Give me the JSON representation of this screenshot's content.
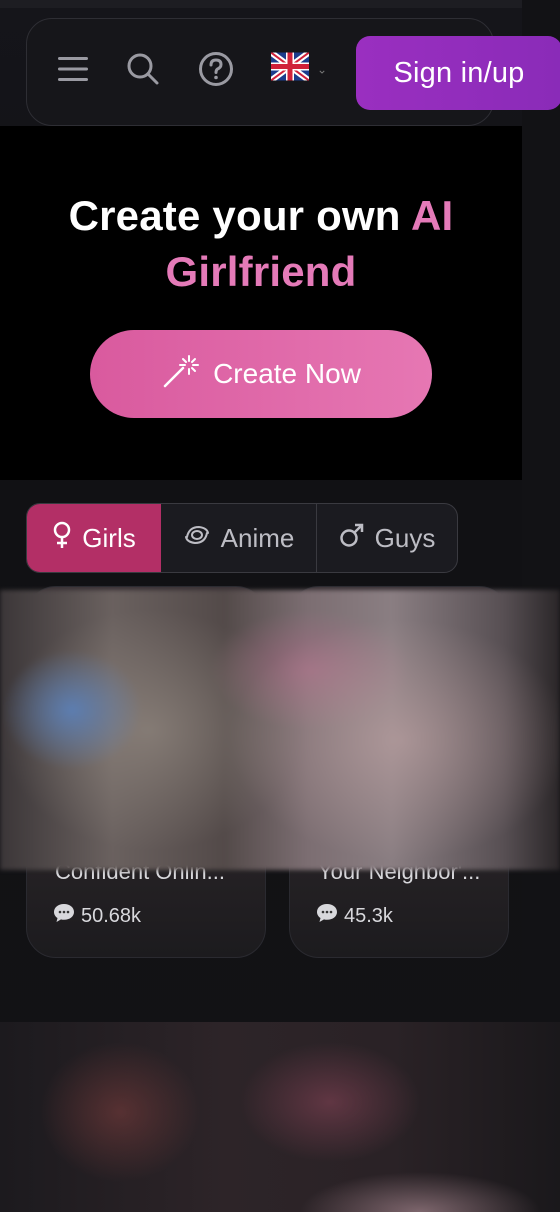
{
  "header": {
    "signin_label": "Sign in/up",
    "icons": [
      "menu-icon",
      "search-icon",
      "help-icon",
      "uk-flag-icon",
      "chevron-down-icon"
    ]
  },
  "hero": {
    "title_part1": "Create your own ",
    "title_accent1": "AI",
    "title_accent2": "Girlfriend",
    "button_label": "Create Now",
    "accent_color": "#e47ab8"
  },
  "tabs": [
    {
      "label": "Girls",
      "icon": "female-icon",
      "active": true
    },
    {
      "label": "Anime",
      "icon": "anime-swirl-icon",
      "active": false
    },
    {
      "label": "Guys",
      "icon": "male-icon",
      "active": false
    }
  ],
  "cards": [
    {
      "name": "Confident Onlin...",
      "chats": "50.68k"
    },
    {
      "name": "Your Neighbor'...",
      "chats": "45.3k"
    }
  ],
  "colors": {
    "signin_bg": "#9a2fc0",
    "create_button": "#e068a8",
    "active_tab": "#b32f66"
  }
}
